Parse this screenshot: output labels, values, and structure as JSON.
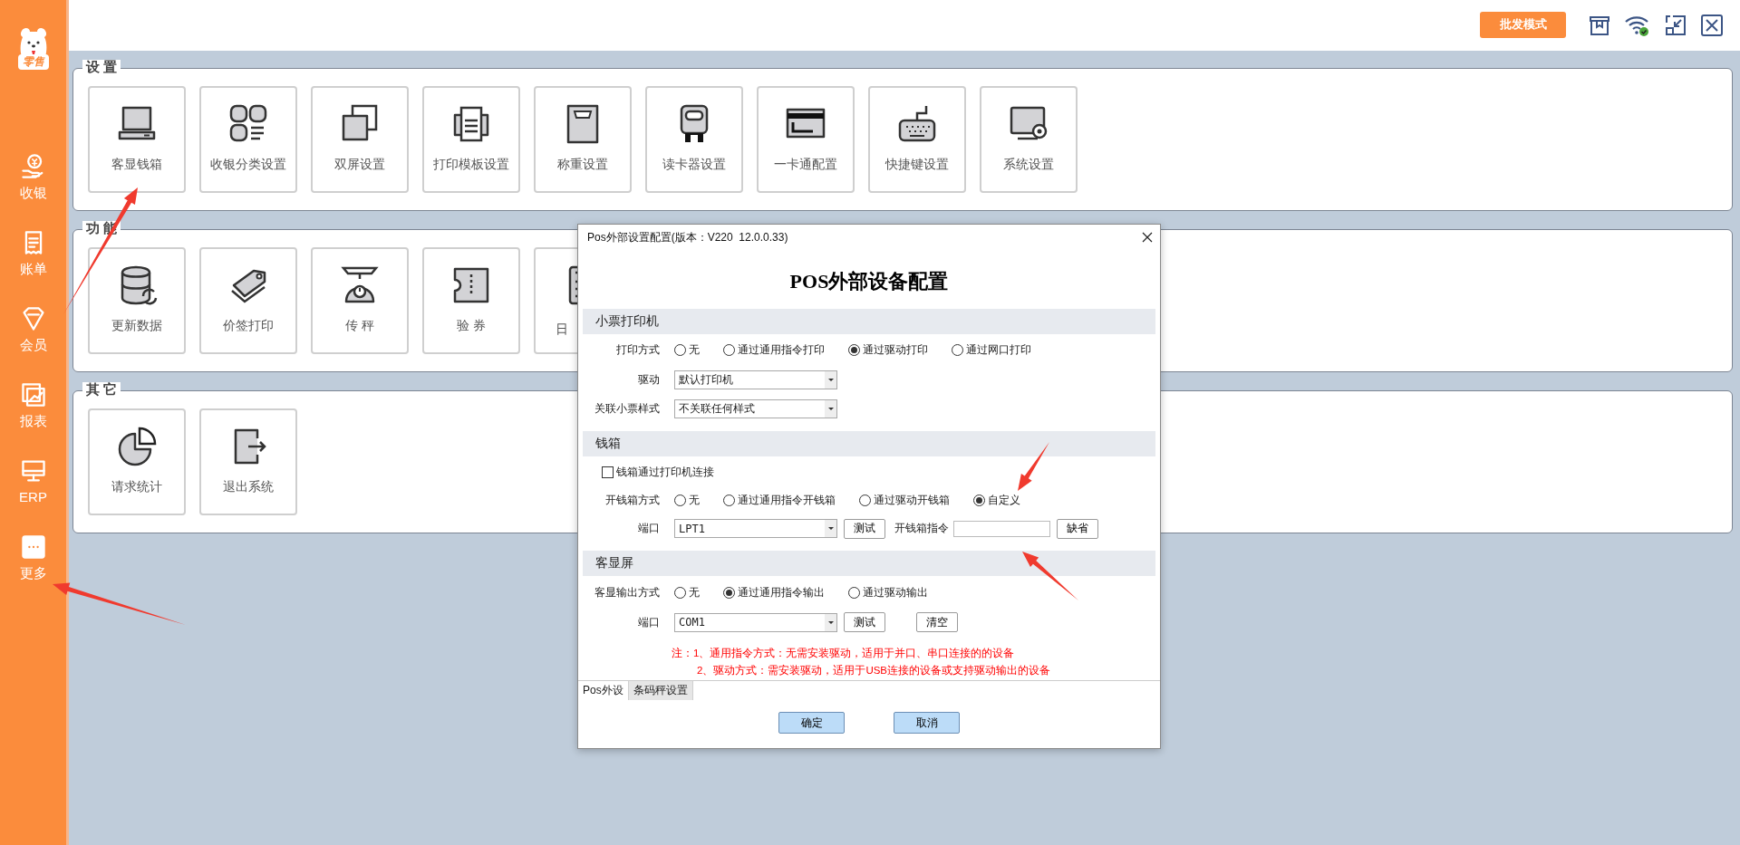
{
  "sidebar": {
    "logo_badge": "零售",
    "items": [
      {
        "label": "收银"
      },
      {
        "label": "账单"
      },
      {
        "label": "会员"
      },
      {
        "label": "报表"
      },
      {
        "label": "ERP"
      },
      {
        "label": "更多"
      }
    ]
  },
  "top_bar": {
    "mode_button": "批发模式"
  },
  "sections": [
    {
      "title": "设 置",
      "tiles": [
        {
          "label": "客显钱箱"
        },
        {
          "label": "收银分类设置"
        },
        {
          "label": "双屏设置"
        },
        {
          "label": "打印模板设置"
        },
        {
          "label": "称重设置"
        },
        {
          "label": "读卡器设置"
        },
        {
          "label": "一卡通配置"
        },
        {
          "label": "快捷键设置"
        },
        {
          "label": "系统设置"
        }
      ]
    },
    {
      "title": "功 能",
      "tiles": [
        {
          "label": "更新数据"
        },
        {
          "label": "价签打印"
        },
        {
          "label": "传 秤"
        },
        {
          "label": "验 券"
        },
        {
          "label": "日",
          "kind": "partial"
        }
      ]
    },
    {
      "title": "其 它",
      "tiles": [
        {
          "label": "请求统计"
        },
        {
          "label": "退出系统"
        }
      ]
    }
  ],
  "dialog": {
    "title": "Pos外部设置配置(版本：V220  12.0.0.33)",
    "heading": "POS外部设备配置",
    "groups": [
      {
        "title": "小票打印机",
        "rows": [
          {
            "kind": "radio",
            "label": "打印方式",
            "options": [
              {
                "label": "无",
                "selected": false
              },
              {
                "label": "通过通用指令打印",
                "selected": false
              },
              {
                "label": "通过驱动打印",
                "selected": true
              },
              {
                "label": "通过网口打印",
                "selected": false
              }
            ]
          },
          {
            "kind": "select",
            "label": "驱动",
            "value": "默认打印机"
          },
          {
            "kind": "select",
            "label": "关联小票样式",
            "value": "不关联任何样式"
          }
        ]
      },
      {
        "title": "钱箱",
        "rows": [
          {
            "kind": "checkbox",
            "label": "钱箱通过打印机连接",
            "checked": false
          },
          {
            "kind": "radio",
            "label": "开钱箱方式",
            "options": [
              {
                "label": "无",
                "selected": false
              },
              {
                "label": "通过通用指令开钱箱",
                "selected": false
              },
              {
                "label": "通过驱动开钱箱",
                "selected": false
              },
              {
                "label": "自定义",
                "selected": true
              }
            ]
          },
          {
            "kind": "port",
            "label": "端口",
            "value": "LPT1",
            "items": [
              {
                "kind": "button",
                "label": "测试"
              },
              {
                "kind": "field",
                "label": "开钱箱指令"
              },
              {
                "kind": "button",
                "label": "缺省"
              }
            ]
          }
        ]
      },
      {
        "title": "客显屏",
        "rows": [
          {
            "kind": "radio",
            "label": "客显输出方式",
            "options": [
              {
                "label": "无",
                "selected": false
              },
              {
                "label": "通过通用指令输出",
                "selected": true
              },
              {
                "label": "通过驱动输出",
                "selected": false
              }
            ]
          },
          {
            "kind": "port",
            "label": "端口",
            "value": "COM1",
            "items": [
              {
                "kind": "button",
                "label": "测试"
              },
              {
                "kind": "button",
                "label": "清空"
              }
            ]
          }
        ]
      }
    ],
    "notes": [
      "注：1、通用指令方式：无需安装驱动，适用于并口、串口连接的的设备",
      "2、驱动方式：需安装驱动，适用于USB连接的设备或支持驱动输出的设备"
    ],
    "tabs": [
      {
        "label": "Pos外设",
        "selected": true
      },
      {
        "label": "条码秤设置",
        "selected": false
      }
    ],
    "buttons": [
      "确定",
      "取消"
    ]
  }
}
